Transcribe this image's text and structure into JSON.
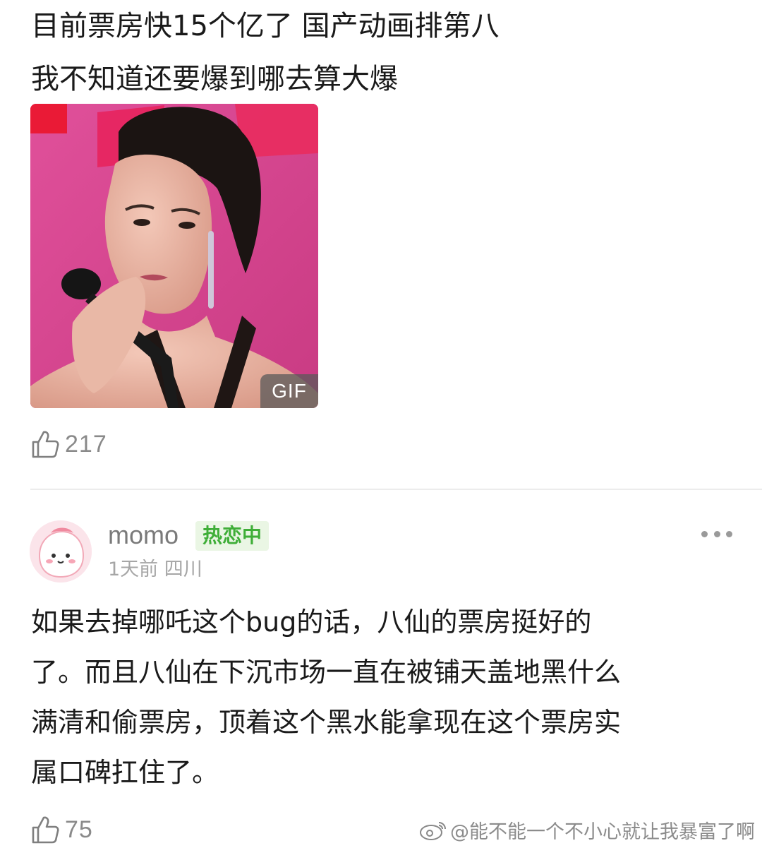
{
  "post": {
    "lines": [
      "目前票房快15个亿了 国产动画排第八",
      "我不知道还要爆到哪去算大爆"
    ],
    "media": {
      "badge": "GIF"
    },
    "likes": "217"
  },
  "comment": {
    "username": "momo",
    "status_badge": "热恋中",
    "time": "1天前",
    "location": "四川",
    "lines": [
      "如果去掉哪吒这个bug的话，八仙的票房挺好的",
      "了。而且八仙在下沉市场一直在被铺天盖地黑什么",
      "满清和偷票房，顶着这个黑水能拿现在这个票房实",
      "属口碑扛住了。"
    ],
    "likes": "75"
  },
  "watermark": {
    "text": "@能不能一个不小心就让我暴富了啊"
  },
  "icons": {
    "like": "thumbs-up-icon",
    "more": "more-dots-icon",
    "weibo": "weibo-logo-icon"
  },
  "colors": {
    "badge_green": "#3fae38",
    "badge_bg": "#eaf6e4",
    "meta_gray": "#a6a6a6",
    "divider": "#ececec"
  }
}
